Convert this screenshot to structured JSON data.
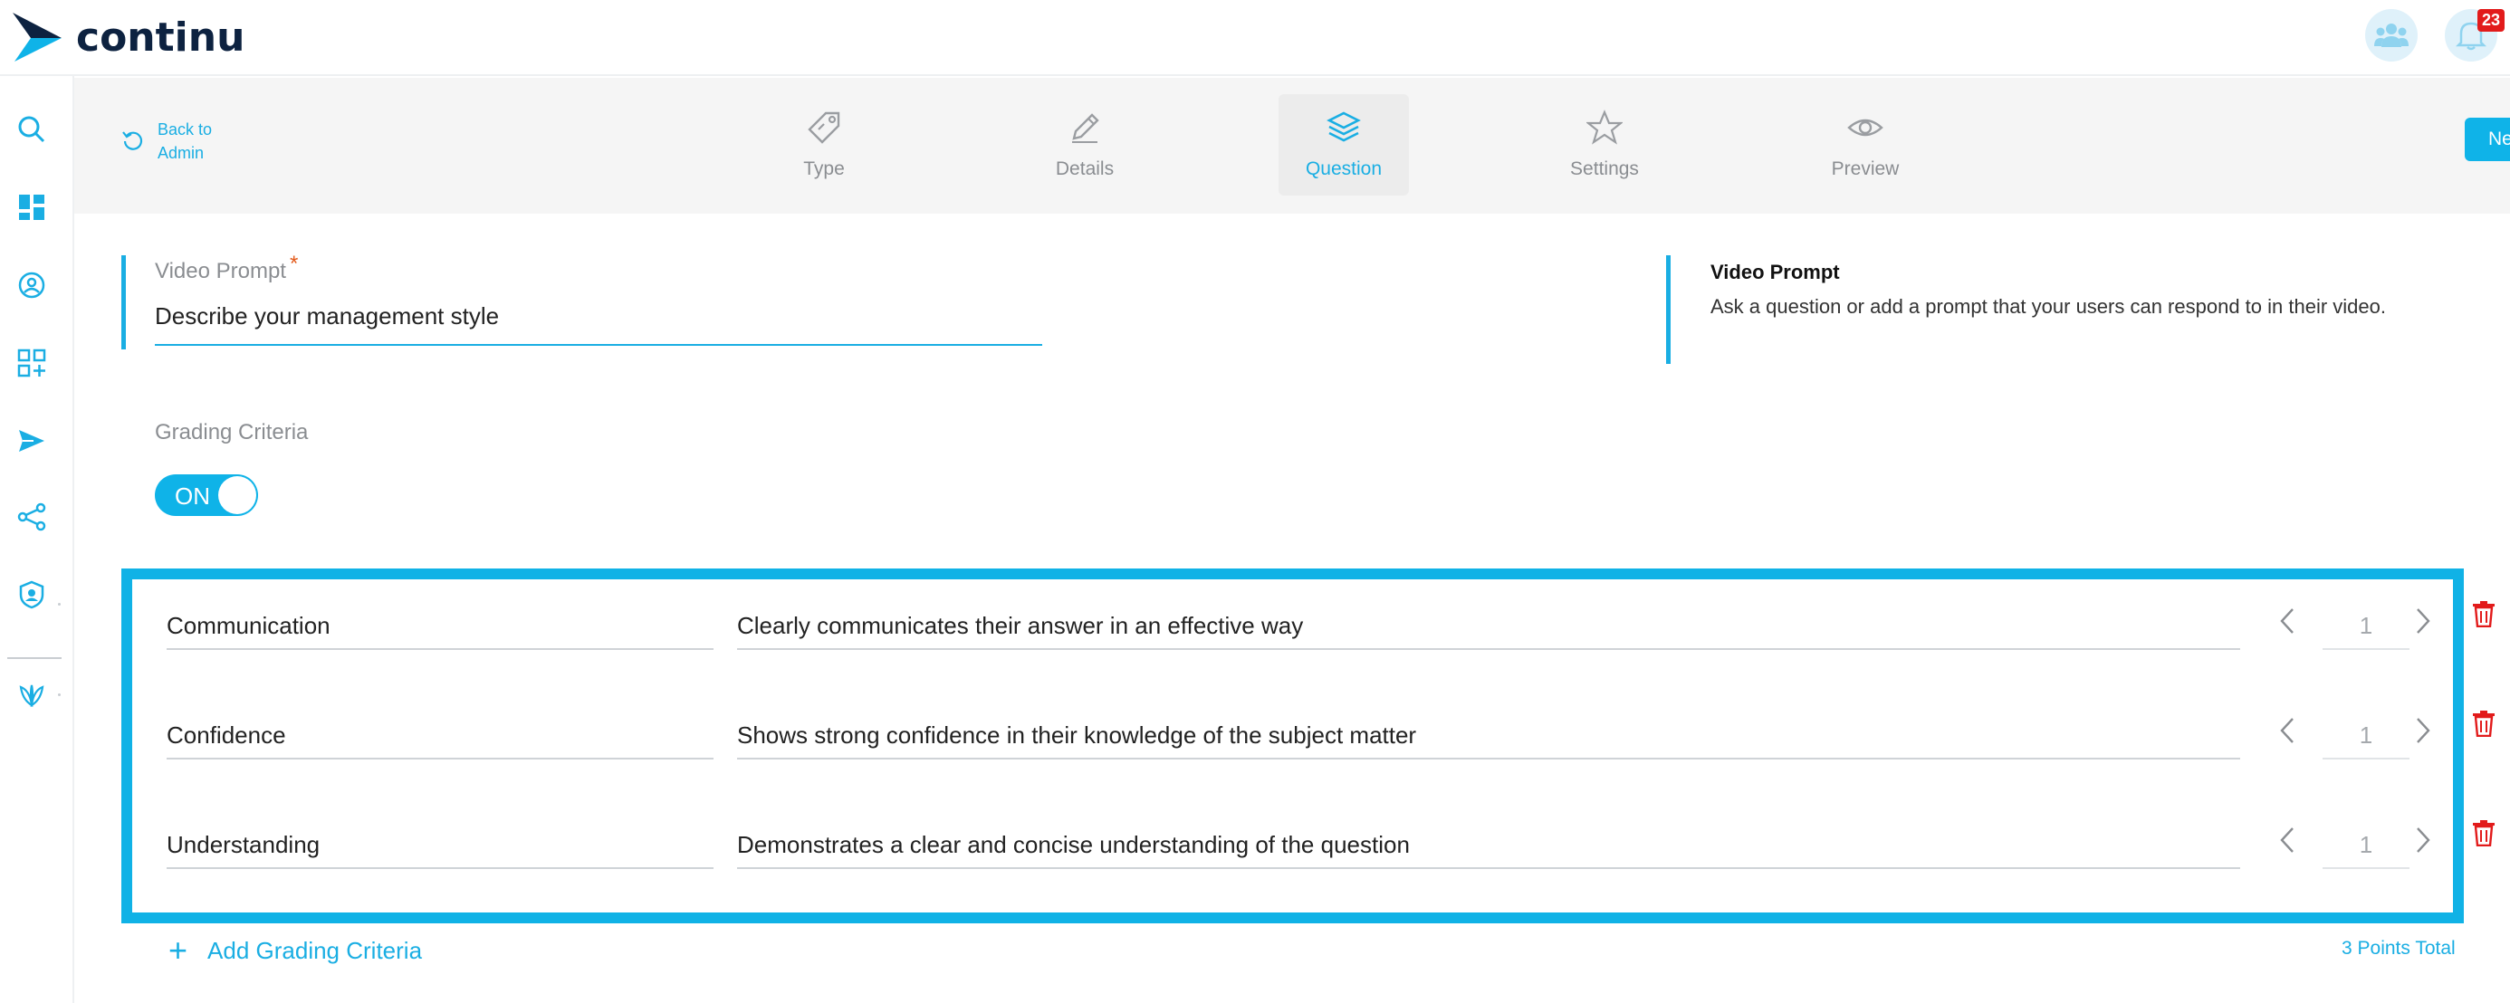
{
  "app": {
    "brand": "continu",
    "notification_count": "23"
  },
  "colors": {
    "accent": "#1aaee3",
    "navy": "#0d2240",
    "danger": "#e21b1b"
  },
  "sidebar": {
    "items": [
      {
        "icon": "search-icon"
      },
      {
        "icon": "dashboard-icon"
      },
      {
        "icon": "explore-icon"
      },
      {
        "icon": "add-apps-icon"
      },
      {
        "icon": "send-icon"
      },
      {
        "icon": "share-icon"
      },
      {
        "icon": "admin-shield-icon"
      },
      {
        "icon": "leaf-icon"
      }
    ]
  },
  "header": {
    "back_line1": "Back to",
    "back_line2": "Admin",
    "tabs": [
      {
        "label": "Type",
        "icon": "tag-icon"
      },
      {
        "label": "Details",
        "icon": "pencil-icon"
      },
      {
        "label": "Question",
        "icon": "layers-icon",
        "active": true
      },
      {
        "label": "Settings",
        "icon": "star-icon"
      },
      {
        "label": "Preview",
        "icon": "eye-icon"
      }
    ],
    "next_label": "Ne"
  },
  "form": {
    "prompt_label": "Video Prompt",
    "required_mark": "*",
    "prompt_value": "Describe your management style",
    "grading_label": "Grading Criteria",
    "toggle_label": "ON"
  },
  "help": {
    "title": "Video Prompt",
    "description": "Ask a question or add a prompt that your users can respond to in their video."
  },
  "criteria": [
    {
      "name": "Communication",
      "description": "Clearly communicates their answer in an effective way",
      "points": "1"
    },
    {
      "name": "Confidence",
      "description": "Shows strong confidence in their knowledge of the subject matter",
      "points": "1"
    },
    {
      "name": "Understanding",
      "description": "Demonstrates a clear and concise understanding of the question",
      "points": "1"
    }
  ],
  "footer": {
    "add_plus": "+",
    "add_label": "Add Grading Criteria",
    "points_total": "3 Points Total"
  }
}
